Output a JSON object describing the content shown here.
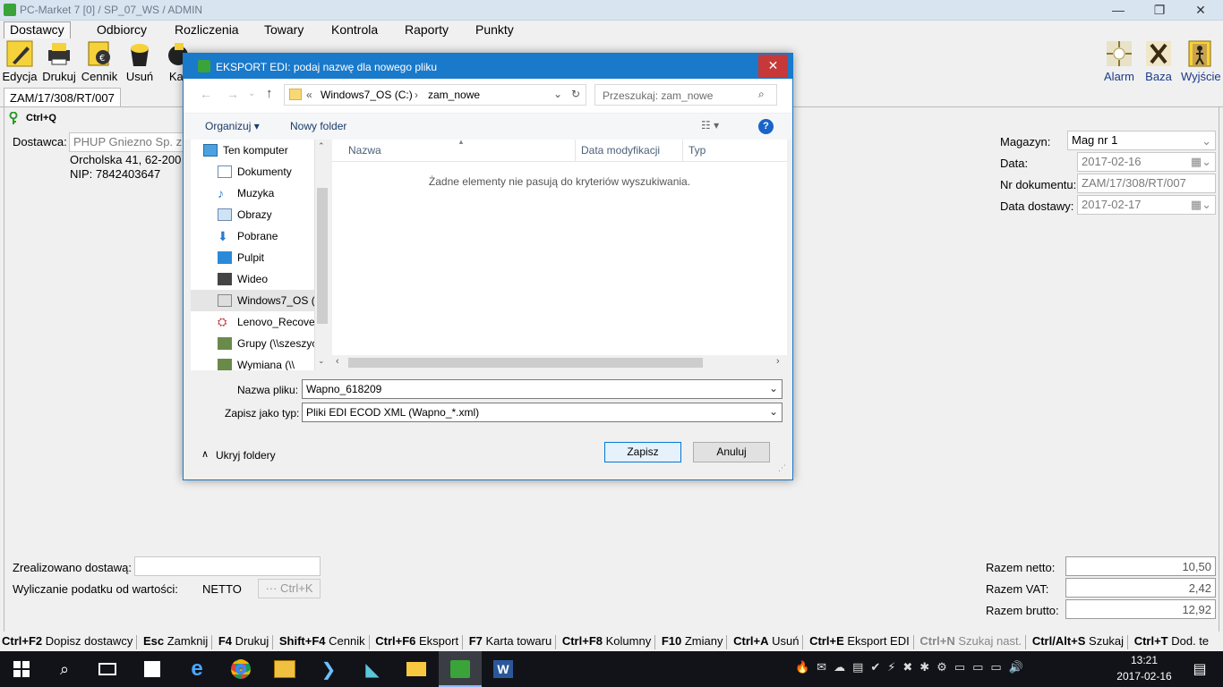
{
  "window": {
    "title": "PC-Market 7 [0] / SP_07_WS / ADMIN",
    "min": "—",
    "max": "❐",
    "close": "✕"
  },
  "menu": [
    "Dostawcy",
    "Odbiorcy",
    "Rozliczenia",
    "Towary",
    "Kontrola",
    "Raporty",
    "Punkty"
  ],
  "toolbar": {
    "left": [
      "Edycja",
      "Drukuj",
      "Cennik",
      "Usuń",
      "Kar"
    ],
    "right": [
      "Alarm",
      "Baza",
      "Wyjście"
    ]
  },
  "doc_tab": "ZAM/17/308/RT/007",
  "shortcut_hint": "Ctrl+Q",
  "supplier": {
    "label": "Dostawca:",
    "name": "PHUP Gniezno Sp. z",
    "address": "Orcholska 41, 62-200",
    "nip": "NIP: 7842403647"
  },
  "right_form": {
    "magazyn_label": "Magazyn:",
    "magazyn_value": "Mag nr 1",
    "data_label": "Data:",
    "data_value": "2017-02-16",
    "nr_label": "Nr dokumentu:",
    "nr_value": "ZAM/17/308/RT/007",
    "dostawa_label": "Data dostawy:",
    "dostawa_value": "2017-02-17"
  },
  "bottom_left": {
    "zrealizowano_label": "Zrealizowano dostawą:",
    "zrealizowano_value": "",
    "podatek_label": "Wyliczanie podatku od wartości:",
    "podatek_value": "NETTO",
    "podatek_btn": "··· Ctrl+K"
  },
  "totals": {
    "netto_label": "Razem netto:",
    "netto_value": "10,50",
    "vat_label": "Razem VAT:",
    "vat_value": "2,42",
    "brutto_label": "Razem brutto:",
    "brutto_value": "12,92"
  },
  "statusbar": [
    {
      "key": "Ctrl+F2",
      "label": "Dopisz dostawcy"
    },
    {
      "key": "Esc",
      "label": "Zamknij"
    },
    {
      "key": "F4",
      "label": "Drukuj"
    },
    {
      "key": "Shift+F4",
      "label": "Cennik"
    },
    {
      "key": "Ctrl+F6",
      "label": "Eksport"
    },
    {
      "key": "F7",
      "label": "Karta towaru"
    },
    {
      "key": "Ctrl+F8",
      "label": "Kolumny"
    },
    {
      "key": "F10",
      "label": "Zmiany"
    },
    {
      "key": "Ctrl+A",
      "label": "Usuń"
    },
    {
      "key": "Ctrl+E",
      "label": "Eksport EDI"
    },
    {
      "key": "Ctrl+N",
      "label": "Szukaj nast."
    },
    {
      "key": "Ctrl/Alt+S",
      "label": "Szukaj"
    },
    {
      "key": "Ctrl+T",
      "label": "Dod. te"
    }
  ],
  "dialog": {
    "title": "EKSPORT EDI: podaj nazwę dla nowego pliku",
    "close": "✕",
    "address": {
      "prefix": "«",
      "part1": "Windows7_OS (C:)",
      "sep": "›",
      "part2": "zam_nowe"
    },
    "search_placeholder": "Przeszukaj: zam_nowe",
    "organize": "Organizuj ▾",
    "new_folder": "Nowy folder",
    "help": "?",
    "nav_items": [
      "Ten komputer",
      "Dokumenty",
      "Muzyka",
      "Obrazy",
      "Pobrane",
      "Pulpit",
      "Wideo",
      "Windows7_OS (C:)",
      "Lenovo_Recovery",
      "Grupy (\\\\szeszycz",
      "Wymiana (\\\\"
    ],
    "columns": {
      "name": "Nazwa",
      "modified": "Data modyfikacji",
      "type": "Typ"
    },
    "empty_message": "Żadne elementy nie pasują do kryteriów wyszukiwania.",
    "filename_label": "Nazwa pliku:",
    "filename_value": "Wapno_618209",
    "filetype_label": "Zapisz jako typ:",
    "filetype_value": "Pliki EDI ECOD XML (Wapno_*.xml)",
    "hide_folders": "Ukryj foldery",
    "save": "Zapisz",
    "cancel": "Anuluj"
  },
  "taskbar": {
    "time": "13:21",
    "date": "2017-02-16"
  },
  "colors": {
    "dialog_accent": "#1979ca",
    "close_red": "#c73838",
    "taskbar": "#111318"
  }
}
